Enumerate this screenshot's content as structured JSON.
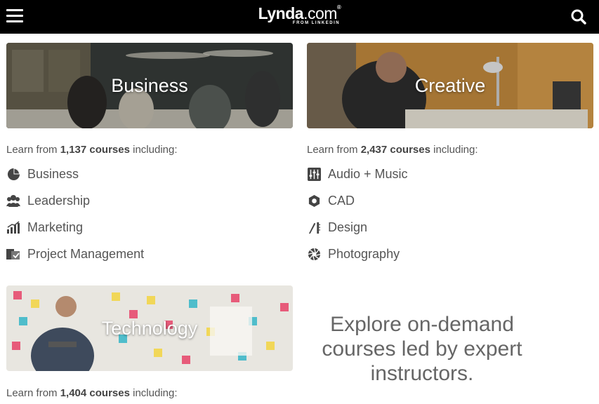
{
  "header": {
    "logo_main": "Lynda",
    "logo_dotcom": ".com",
    "logo_reg": "®",
    "logo_sub": "FROM LINKEDIN"
  },
  "categories": [
    {
      "title": "Business",
      "learn_prefix": "Learn from ",
      "count": "1,137 courses",
      "learn_suffix": " including:",
      "items": [
        "Business",
        "Leadership",
        "Marketing",
        "Project Management"
      ]
    },
    {
      "title": "Creative",
      "learn_prefix": "Learn from ",
      "count": "2,437 courses",
      "learn_suffix": " including:",
      "items": [
        "Audio + Music",
        "CAD",
        "Design",
        "Photography"
      ]
    },
    {
      "title": "Technology",
      "learn_prefix": "Learn from ",
      "count": "1,404 courses",
      "learn_suffix": " including:"
    }
  ],
  "explore": {
    "line1": "Explore on-demand",
    "line2": "courses led by expert",
    "line3": "instructors."
  },
  "icons": {
    "business": [
      "pie-chart-icon",
      "people-icon",
      "bar-chart-icon",
      "project-icon"
    ],
    "creative": [
      "mixer-icon",
      "hexagon-icon",
      "pen-ruler-icon",
      "aperture-icon"
    ]
  },
  "colors": {
    "topbar": "#000000",
    "text": "#555555"
  }
}
